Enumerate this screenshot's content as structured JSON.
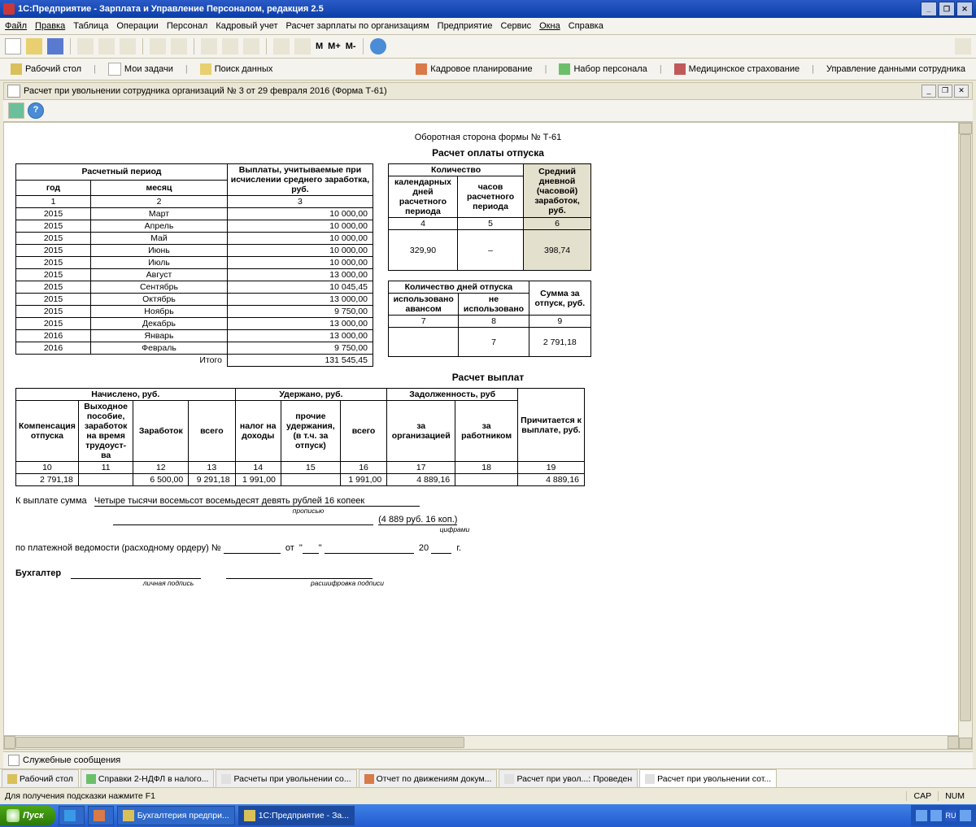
{
  "title": "1С:Предприятие - Зарплата и Управление Персоналом, редакция 2.5",
  "menu": [
    "Файл",
    "Правка",
    "Таблица",
    "Операции",
    "Персонал",
    "Кадровый учет",
    "Расчет зарплаты по организациям",
    "Предприятие",
    "Сервис",
    "Окна",
    "Справка"
  ],
  "toolbar_m": [
    "M",
    "M+",
    "M-"
  ],
  "nav2": {
    "desktop": "Рабочий стол",
    "tasks": "Мои задачи",
    "search": "Поиск данных",
    "planning": "Кадровое планирование",
    "recruit": "Набор персонала",
    "med": "Медицинское страхование",
    "mgmt": "Управление данными сотрудника"
  },
  "doc_title": "Расчет при увольнении сотрудника организаций № 3 от 29 февраля 2016 (Форма Т-61)",
  "form_header": "Оборотная сторона формы № Т-61",
  "section1": "Расчет оплаты отпуска",
  "periods_header": {
    "main": "Расчетный период",
    "year": "год",
    "month": "месяц",
    "pay": "Выплаты, учитываемые при исчислении среднего заработка, руб."
  },
  "col_nums_a": [
    "1",
    "2",
    "3"
  ],
  "periods": [
    {
      "y": "2015",
      "m": "Март",
      "v": "10 000,00"
    },
    {
      "y": "2015",
      "m": "Апрель",
      "v": "10 000,00"
    },
    {
      "y": "2015",
      "m": "Май",
      "v": "10 000,00"
    },
    {
      "y": "2015",
      "m": "Июнь",
      "v": "10 000,00"
    },
    {
      "y": "2015",
      "m": "Июль",
      "v": "10 000,00"
    },
    {
      "y": "2015",
      "m": "Август",
      "v": "13 000,00"
    },
    {
      "y": "2015",
      "m": "Сентябрь",
      "v": "10 045,45"
    },
    {
      "y": "2015",
      "m": "Октябрь",
      "v": "13 000,00"
    },
    {
      "y": "2015",
      "m": "Ноябрь",
      "v": "9 750,00"
    },
    {
      "y": "2015",
      "m": "Декабрь",
      "v": "13 000,00"
    },
    {
      "y": "2016",
      "m": "Январь",
      "v": "13 000,00"
    },
    {
      "y": "2016",
      "m": "Февраль",
      "v": "9 750,00"
    }
  ],
  "total_label": "Итого",
  "total_value": "131 545,45",
  "qty": {
    "header": "Количество",
    "days": "календарных дней расчетного периода",
    "hours": "часов расчетного периода",
    "avg": "Средний дневной (часовой) заработок, руб."
  },
  "col_nums_b": [
    "4",
    "5",
    "6"
  ],
  "qty_vals": {
    "days": "329,90",
    "hours": "–",
    "avg": "398,74"
  },
  "vac": {
    "header": "Количество дней отпуска",
    "used": "использовано авансом",
    "unused": "не использовано",
    "sum": "Сумма за отпуск, руб."
  },
  "col_nums_c": [
    "7",
    "8",
    "9"
  ],
  "vac_vals": {
    "used": "",
    "unused": "7",
    "sum": "2 791,18"
  },
  "section2": "Расчет выплат",
  "pay_hdr": {
    "accrued": "Начислено, руб.",
    "withheld": "Удержано, руб.",
    "debt": "Задолженность, руб",
    "due": "Причитается к выплате, руб."
  },
  "pay_cols": {
    "comp": "Компенсация отпуска",
    "sev": "Выходное пособие, заработок на время трудоуст-ва",
    "earn": "Заработок",
    "atot": "всего",
    "tax": "налог на доходы",
    "oth": "прочие удержания, (в т.ч. за отпуск)",
    "wtot": "всего",
    "dorg": "за организацией",
    "demp": "за работником"
  },
  "col_nums_d": [
    "10",
    "11",
    "12",
    "13",
    "14",
    "15",
    "16",
    "17",
    "18",
    "19"
  ],
  "pay_row": {
    "c10": "2 791,18",
    "c11": "",
    "c12": "6 500,00",
    "c13": "9 291,18",
    "c14": "1 991,00",
    "c15": "",
    "c16": "1 991,00",
    "c17": "4 889,16",
    "c18": "",
    "c19": "4 889,16"
  },
  "footer": {
    "sum_label": "К выплате сумма",
    "sum_words": "Четыре тысячи восемьсот восемьдесят девять рублей 16 копеек",
    "propis": "прописью",
    "sum_num": "(4 889 руб. 16 коп.)",
    "cifr": "цифрами",
    "ved": "по платежной ведомости (расходному ордеру) №",
    "ot": "от",
    "year20": "20",
    "g": "г.",
    "acc": "Бухгалтер",
    "sign": "личная подпись",
    "decode": "расшифровка подписи"
  },
  "msgbar": "Служебные сообщения",
  "tabs": [
    {
      "l": "Рабочий стол",
      "ic": "#d9c05a"
    },
    {
      "l": "Справки 2-НДФЛ в налого...",
      "ic": "#6bbf6b"
    },
    {
      "l": "Расчеты при увольнении со...",
      "ic": "#e0e0e0"
    },
    {
      "l": "Отчет по движениям докум...",
      "ic": "#d97a4a"
    },
    {
      "l": "Расчет при увол...: Проведен",
      "ic": "#e0e0e0"
    },
    {
      "l": "Расчет при увольнении сот...",
      "ic": "#e0e0e0",
      "active": true
    }
  ],
  "status_hint": "Для получения подсказки нажмите F1",
  "status_caps": "CAP",
  "status_num": "NUM",
  "taskbar": {
    "start": "Пуск",
    "btns": [
      {
        "l": "",
        "ic": "#389ae6"
      },
      {
        "l": "",
        "ic": "#d97a4a"
      },
      {
        "l": "Бухгалтерия предпри...",
        "ic": "#d9c05a"
      },
      {
        "l": "1С:Предприятие - За...",
        "ic": "#d9c05a",
        "act": true
      }
    ],
    "lang": "RU"
  }
}
